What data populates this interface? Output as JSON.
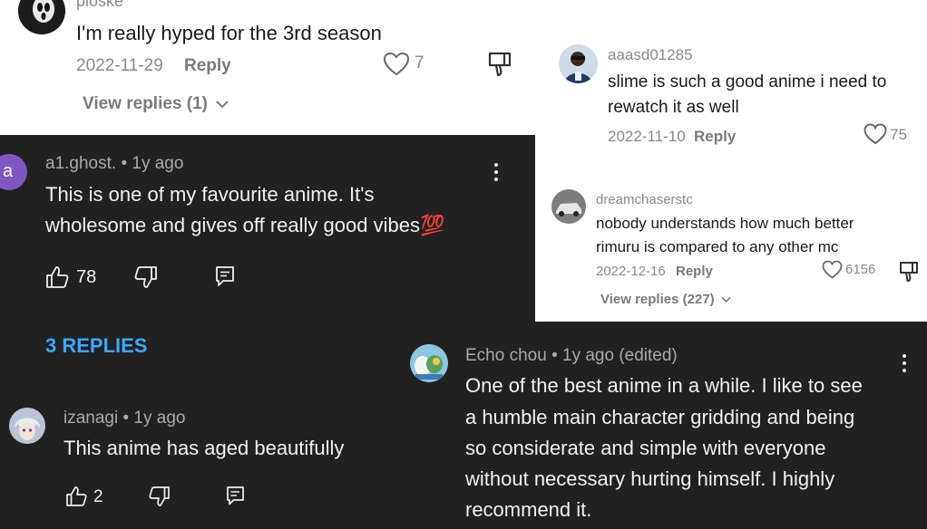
{
  "comment_top": {
    "username": "ploske",
    "text": "I'm really hyped for the 3rd season",
    "date": "2022-11-29",
    "reply_label": "Reply",
    "likes": "7",
    "view_replies": "View replies (1)"
  },
  "comment_aaasd": {
    "username": "aaasd01285",
    "text_line1": "slime is such a good anime i need to",
    "text_line2": "rewatch it as well",
    "date": "2022-11-10",
    "reply_label": "Reply",
    "likes": "75"
  },
  "comment_dream": {
    "username": "dreamchaserstc",
    "text_line1": "nobody understands how much better",
    "text_line2": "rimuru is compared to any other mc",
    "date": "2022-12-16",
    "reply_label": "Reply",
    "likes": "6156",
    "view_replies": "View replies (227)"
  },
  "comment_ghost": {
    "avatar_letter": "a",
    "username": "a1.ghost.",
    "time": "• 1y ago",
    "text_line1": "This is one of my favourite anime. It's",
    "text_line2": "wholesome and gives off really good vibes",
    "emoji": "💯",
    "likes": "78",
    "replies_toggle": "3 REPLIES"
  },
  "comment_izanagi": {
    "username": "izanagi",
    "time": "• 1y ago",
    "text": "This anime has aged beautifully",
    "likes": "2"
  },
  "comment_echo": {
    "username": "Echo chou",
    "time": "• 1y ago (edited)",
    "text_lines": [
      "One of the best anime in a while. I like to see",
      "a humble main character gridding and being",
      "so considerate and simple with everyone",
      "without necessary hurting himself. I highly",
      "recommend it."
    ]
  },
  "colors": {
    "dark_bg": "#212121",
    "light_bg": "#ffffff",
    "accent_blue": "#3ea6ff",
    "avatar_purple": "#7e57c2"
  },
  "icons": [
    "heart-icon",
    "dislike-icon",
    "thumbs-up-icon",
    "thumbs-down-icon",
    "reply-icon",
    "more-vert-icon",
    "chevron-down-icon"
  ]
}
